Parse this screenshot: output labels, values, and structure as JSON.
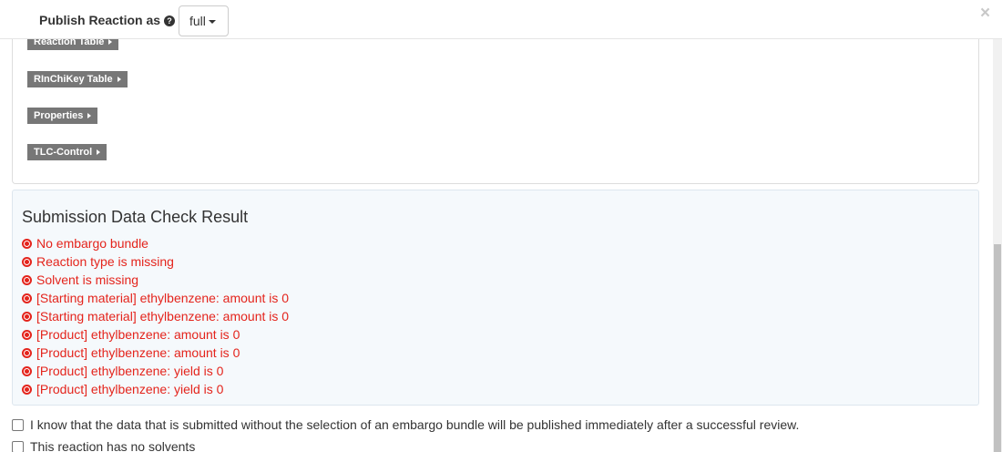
{
  "header": {
    "publish_label": "Publish Reaction as",
    "mode_value": "full"
  },
  "sections": [
    {
      "label": "Reaction Table"
    },
    {
      "label": "RInChiKey Table"
    },
    {
      "label": "Properties"
    },
    {
      "label": "TLC-Control"
    }
  ],
  "check_result": {
    "title": "Submission Data Check Result",
    "items": [
      "No embargo bundle",
      "Reaction type is missing",
      "Solvent is missing",
      "[Starting material] ethylbenzene: amount is 0",
      "[Starting material] ethylbenzene: amount is 0",
      "[Product] ethylbenzene: amount is 0",
      "[Product] ethylbenzene: amount is 0",
      "[Product] ethylbenzene: yield is 0",
      "[Product] ethylbenzene: yield is 0"
    ],
    "error_color": "#e4241c"
  },
  "checkboxes": {
    "embargo_ack": "I know that the data that is submitted without the selection of an embargo bundle will be published immediately after a successful review.",
    "no_solvents": "This reaction has no solvents"
  },
  "icons": {
    "help": "question-circle-icon",
    "close": "close-icon",
    "error": "times-circle-icon",
    "caret": "caret-down-icon",
    "section_arrow": "caret-right-icon"
  }
}
